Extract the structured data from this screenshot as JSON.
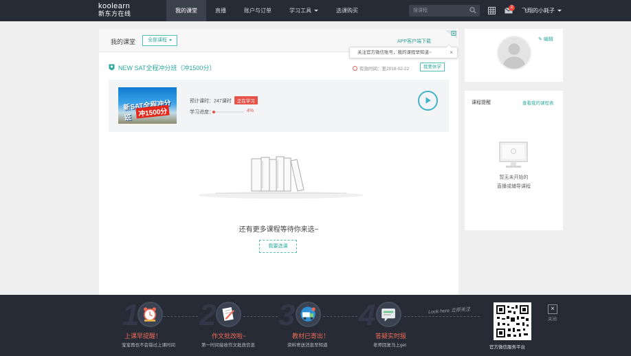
{
  "brand": {
    "en": "koolearn",
    "cn": "新东方在线"
  },
  "nav": {
    "items": [
      {
        "label": "我的课堂"
      },
      {
        "label": "直播"
      },
      {
        "label": "账户与订单"
      },
      {
        "label": "学习工具"
      },
      {
        "label": "选课购买"
      }
    ],
    "active": "我的课堂",
    "search_placeholder": "搜课程",
    "mail_count": "2",
    "username": "飞翔的小耗子"
  },
  "main": {
    "title": "我的课堂",
    "filter_label": "全部课程",
    "app_download": "APP客户端下载",
    "tooltip": "关注官方微信账号，我的课程早知道~",
    "tooltip_close": "×",
    "course": {
      "name": "NEW SAT全程冲分班（冲1500分）",
      "valid_label": "有效时间：至2018-02-22",
      "leave_button": "我要休学",
      "thumb_line1": "新SAT全程冲分班",
      "thumb_line2": "冲1500分",
      "hours_label": "预计课时：",
      "hours_value": "247课时",
      "status": "正在学习",
      "progress_label": "学习进度：",
      "progress_percent": 4,
      "progress_text": "4%"
    },
    "empty_text": "还有更多课程等待你来选~",
    "choose_button": "我要选课"
  },
  "profile": {
    "edit_label": "编辑"
  },
  "reminder": {
    "title": "课程提醒",
    "link": "查看我的课程表",
    "empty_line1": "暂无未开始的",
    "empty_line2": "直播或辅导课程"
  },
  "footer": {
    "steps": [
      {
        "num": "1",
        "title": "上课早提醒！",
        "sub": "宝宝再也不会错过上课时间",
        "icon": "alarm-clock-icon"
      },
      {
        "num": "2",
        "title": "作文批改啦~",
        "sub": "第一时间接收作文批改信息",
        "icon": "essay-pencil-icon"
      },
      {
        "num": "3",
        "title": "教材已寄出！",
        "sub": "资料寄送消息早知道",
        "icon": "delivery-truck-icon"
      },
      {
        "num": "4",
        "title": "答疑实时报",
        "sub": "老师回复马上get",
        "icon": "chat-bubble-icon"
      }
    ],
    "look_here": "Look here 立即关注",
    "qr_label": "官方微信服务平台",
    "close_label": "关闭",
    "close_symbol": "×"
  },
  "colors": {
    "accent": "#2ea99e",
    "alert": "#e5534b",
    "topbar": "#262b36",
    "footer_title": "#ef6a55"
  }
}
